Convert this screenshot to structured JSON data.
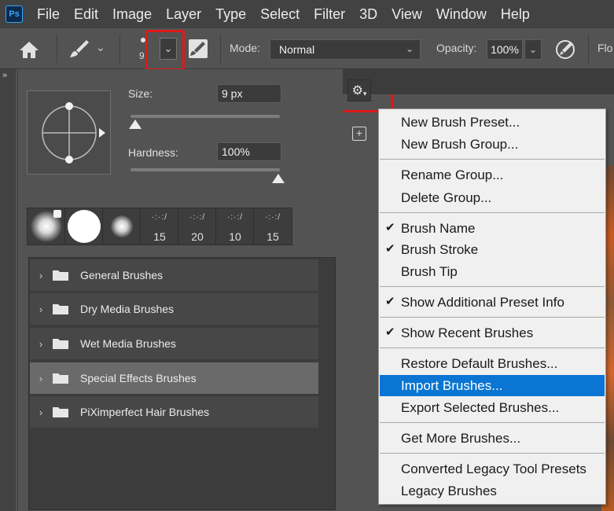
{
  "app": {
    "logo": "Ps",
    "menu": [
      "File",
      "Edit",
      "Image",
      "Layer",
      "Type",
      "Select",
      "Filter",
      "3D",
      "View",
      "Window",
      "Help"
    ]
  },
  "options_bar": {
    "brush_size_value": "9",
    "mode_label": "Mode:",
    "mode_value": "Normal",
    "opacity_label": "Opacity:",
    "opacity_value": "100%",
    "flow_label": "Flo",
    "icons": [
      "home-icon",
      "brush-tool-icon",
      "chevron-down-icon",
      "toggle-brush-panel-icon",
      "pressure-opacity-icon"
    ]
  },
  "brush_panel": {
    "size_label": "Size:",
    "size_value": "9 px",
    "hardness_label": "Hardness:",
    "hardness_value": "100%",
    "recent_brush_sizes": [
      "15",
      "20",
      "10",
      "15"
    ],
    "groups": [
      {
        "name": "General Brushes",
        "selected": false
      },
      {
        "name": "Dry Media Brushes",
        "selected": false
      },
      {
        "name": "Wet Media Brushes",
        "selected": false
      },
      {
        "name": "Special Effects Brushes",
        "selected": true
      },
      {
        "name": "PiXimperfect Hair Brushes",
        "selected": false
      }
    ]
  },
  "context_menu": {
    "items": [
      {
        "label": "New Brush Preset...",
        "checked": false
      },
      {
        "label": "New Brush Group...",
        "checked": false
      },
      {
        "label": "Rename Group...",
        "checked": false
      },
      {
        "label": "Delete Group...",
        "checked": false
      },
      {
        "label": "Brush Name",
        "checked": true
      },
      {
        "label": "Brush Stroke",
        "checked": true
      },
      {
        "label": "Brush Tip",
        "checked": false
      },
      {
        "label": "Show Additional Preset Info",
        "checked": true
      },
      {
        "label": "Show Recent Brushes",
        "checked": true
      },
      {
        "label": "Restore Default Brushes...",
        "checked": false
      },
      {
        "label": "Import Brushes...",
        "checked": false,
        "highlighted": true
      },
      {
        "label": "Export Selected Brushes...",
        "checked": false
      },
      {
        "label": "Get More Brushes...",
        "checked": false
      },
      {
        "label": "Converted Legacy Tool Presets",
        "checked": false
      },
      {
        "label": "Legacy Brushes",
        "checked": false
      }
    ]
  },
  "colors": {
    "highlight": "#0a75d2",
    "annotation_red": "#e01919",
    "ps_blue": "#31a8ff"
  }
}
